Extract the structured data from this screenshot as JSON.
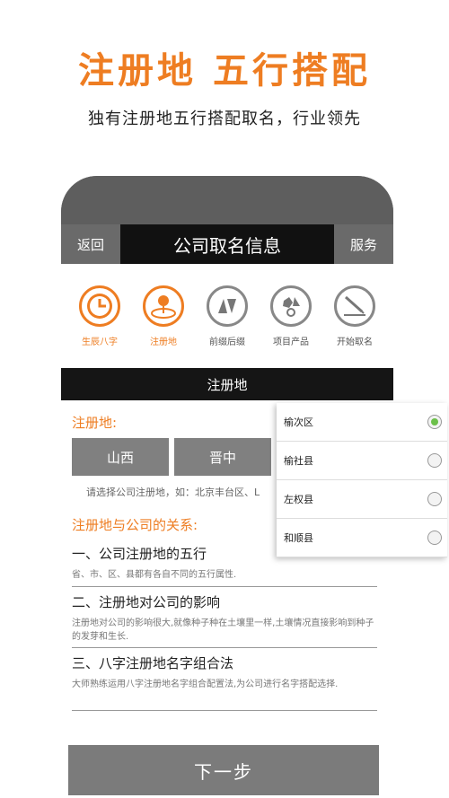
{
  "promo": {
    "title": "注册地 五行搭配",
    "subtitle": "独有注册地五行搭配取名，行业领先"
  },
  "header": {
    "back_label": "返回",
    "title": "公司取名信息",
    "service_label": "服务"
  },
  "steps": [
    {
      "label": "生辰八字",
      "icon": "clock-icon",
      "active": true
    },
    {
      "label": "注册地",
      "icon": "location-pin-icon",
      "active": true
    },
    {
      "label": "前缀后缀",
      "icon": "triangles-icon",
      "active": false
    },
    {
      "label": "项目产品",
      "icon": "shapes-icon",
      "active": false
    },
    {
      "label": "开始取名",
      "icon": "pen-icon",
      "active": false
    }
  ],
  "section_bar": {
    "label": "注册地"
  },
  "registration": {
    "label": "注册地:",
    "province": "山西",
    "city": "晋中",
    "hint": "请选择公司注册地，如：北京丰台区、L"
  },
  "relation": {
    "label": "注册地与公司的关系:",
    "items": [
      {
        "title": "一、公司注册地的五行",
        "desc": "省、市、区、县都有各自不同的五行属性."
      },
      {
        "title": "二、注册地对公司的影响",
        "desc": "注册地对公司的影响很大,就像种子种在土壤里一样,土壤情况直接影响到种子的发芽和生长."
      },
      {
        "title": "三、八字注册地名字组合法",
        "desc": "大师熟练运用八字注册地名字组合配置法,为公司进行名字搭配选择."
      }
    ]
  },
  "next_button": {
    "label": "下一步"
  },
  "dropdown": {
    "options": [
      {
        "label": "榆次区",
        "selected": true
      },
      {
        "label": "榆社县",
        "selected": false
      },
      {
        "label": "左权县",
        "selected": false
      },
      {
        "label": "和顺县",
        "selected": false
      }
    ]
  },
  "colors": {
    "accent": "#ee7d22",
    "dark": "#111111",
    "gray": "#808080",
    "radio_selected": "#6cc04a"
  }
}
